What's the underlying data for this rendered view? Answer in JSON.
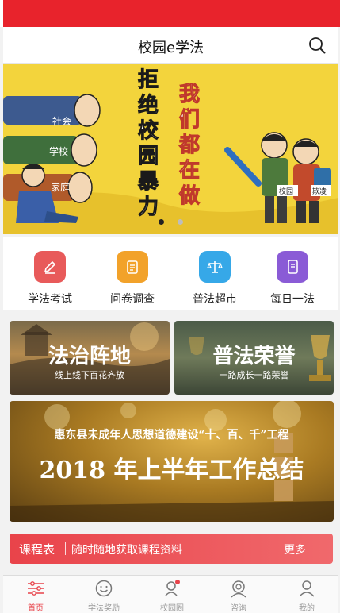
{
  "header": {
    "title": "校园e学法"
  },
  "banner": {
    "headline_chars": [
      "拒",
      "绝",
      "校",
      "园",
      "暴",
      "力"
    ],
    "slogan_chars": [
      "我",
      "们",
      "都",
      "在",
      "做"
    ],
    "fists": [
      "社会",
      "学校",
      "家庭"
    ],
    "bag_labels": [
      "校园",
      "欺凌"
    ],
    "page_count": 2,
    "active_page": 1
  },
  "quick_links": [
    {
      "label": "学法考试",
      "icon": "pencil-icon",
      "color": "#e85a5a"
    },
    {
      "label": "问卷调查",
      "icon": "clipboard-icon",
      "color": "#f2a22a"
    },
    {
      "label": "普法超市",
      "icon": "scales-icon",
      "color": "#36a8e8"
    },
    {
      "label": "每日一法",
      "icon": "book-icon",
      "color": "#8a5bd6"
    }
  ],
  "cards": {
    "left": {
      "title": "法治阵地",
      "subtitle": "线上线下百花齐放"
    },
    "right": {
      "title": "普法荣誉",
      "subtitle": "一路成长一路荣誉"
    }
  },
  "report_banner": {
    "line1": "惠东县未成年人思想道德建设“十、百、千”工程",
    "line2": "2018 年上半年工作总结"
  },
  "course": {
    "title": "课程表",
    "desc": "随时随地获取课程资料",
    "more": "更多"
  },
  "tabs": [
    {
      "label": "首页",
      "icon": "home-icon",
      "active": true
    },
    {
      "label": "学法奖励",
      "icon": "smile-icon",
      "active": false
    },
    {
      "label": "校园圈",
      "icon": "circle-icon",
      "active": false
    },
    {
      "label": "咨询",
      "icon": "consult-icon",
      "active": false
    },
    {
      "label": "我的",
      "icon": "profile-icon",
      "active": false
    }
  ],
  "colors": {
    "brand_red": "#e8232c",
    "tab_active": "#e8434a",
    "tab_inactive": "#999999"
  }
}
